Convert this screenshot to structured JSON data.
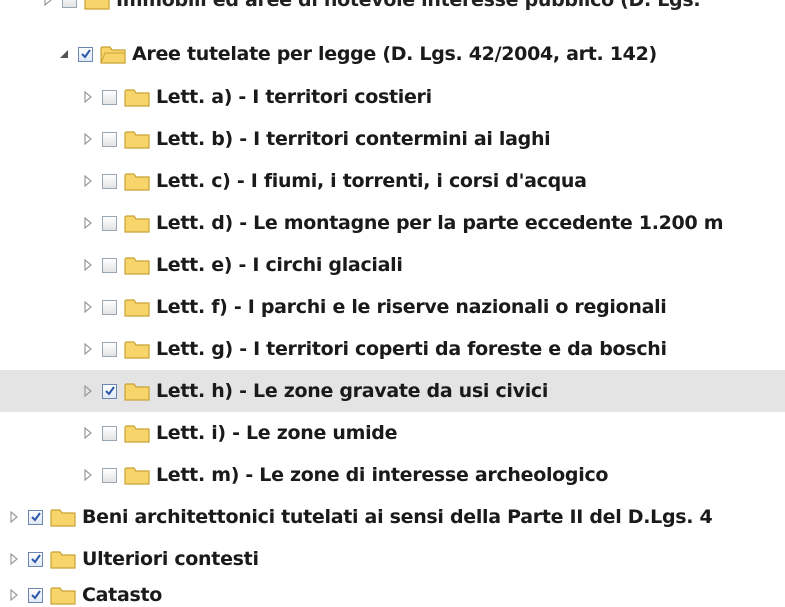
{
  "tree": {
    "top_partial_label": "Immobili ed aree di notevole interesse pubblico (D. Lgs.",
    "items": [
      {
        "label": "Aree tutelate per legge (D. Lgs. 42/2004, art. 142)",
        "checked": true,
        "expanded": true
      },
      {
        "label": "Lett. a) - I territori costieri",
        "checked": false,
        "expanded": false
      },
      {
        "label": "Lett. b) - I territori contermini ai laghi",
        "checked": false,
        "expanded": false
      },
      {
        "label": "Lett. c) - I fiumi, i torrenti, i corsi d'acqua",
        "checked": false,
        "expanded": false
      },
      {
        "label": "Lett. d) - Le montagne per la parte eccedente 1.200 m",
        "checked": false,
        "expanded": false
      },
      {
        "label": "Lett. e) - I circhi glaciali",
        "checked": false,
        "expanded": false
      },
      {
        "label": "Lett. f) - I parchi e le riserve nazionali o regionali",
        "checked": false,
        "expanded": false
      },
      {
        "label": "Lett. g) - I territori coperti da foreste e da boschi",
        "checked": false,
        "expanded": false
      },
      {
        "label": "Lett. h) - Le zone gravate da usi civici",
        "checked": true,
        "expanded": false,
        "selected": true
      },
      {
        "label": "Lett. i) - Le zone umide",
        "checked": false,
        "expanded": false
      },
      {
        "label": "Lett. m) - Le zone di interesse archeologico",
        "checked": false,
        "expanded": false
      },
      {
        "label": "Beni architettonici tutelati ai sensi della Parte II del D.Lgs. 4",
        "checked": true,
        "expanded": false
      },
      {
        "label": "Ulteriori contesti",
        "checked": true,
        "expanded": false
      },
      {
        "label": "Catasto",
        "checked": true,
        "expanded": false
      }
    ]
  },
  "colors": {
    "selected_row": "#e4e4e4",
    "folder_fill": "#f7d56b",
    "folder_stroke": "#c9a233",
    "check_mark": "#2a58a8",
    "expander": "#9a9a9a"
  },
  "icons": {
    "expander_collapsed": "triangle-right-icon",
    "expander_expanded": "triangle-down-icon",
    "folder": "folder-icon",
    "checkbox": "checkbox-icon"
  }
}
